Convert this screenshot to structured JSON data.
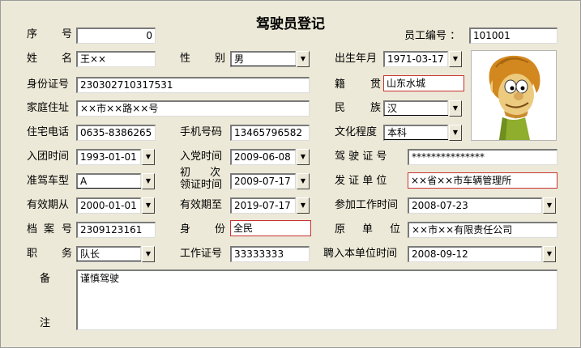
{
  "form": {
    "title": "驾驶员登记",
    "labels": {
      "seq_a": "序",
      "seq_b": "号",
      "employee_no": "员工编号 ：",
      "name_a": "姓",
      "name_b": "名",
      "gender_a": "性",
      "gender_b": "别",
      "birth_date": "出生年月",
      "id_card": "身份证号",
      "origin_a": "籍",
      "origin_b": "贯",
      "address": "家庭住址",
      "ethnic_a": "民",
      "ethnic_b": "族",
      "home_phone": "住宅电话",
      "mobile": "手机号码",
      "education": "文化程度",
      "league_date": "入团时间",
      "party_date": "入党时间",
      "license_no": "驾 驶 证 号",
      "vehicle_type": "准驾车型",
      "first_issue_a": "初 次",
      "first_issue_b": "领证时间",
      "issuer": "发 证 单 位",
      "valid_from": "有效期从",
      "valid_to": "有效期至",
      "work_start": "参加工作时间",
      "file_no_a": "档",
      "file_no_b": "案",
      "file_no_c": "号",
      "status_a": "身",
      "status_b": "份",
      "prev_unit_a": "原",
      "prev_unit_b": "单",
      "prev_unit_c": "位",
      "position_a": "职",
      "position_b": "务",
      "work_id": "工作证号",
      "hire_date": "聘入本单位时间",
      "remarks_a": "备",
      "remarks_b": "注"
    },
    "values": {
      "seq": "0",
      "employee_no": "101001",
      "name": "王××",
      "gender": "男",
      "birth_date": "1971-03-17",
      "id_card": "230302710317531",
      "origin": "山东水城",
      "address": "××市××路××号",
      "ethnic": "汉",
      "home_phone": "0635-8386265",
      "mobile": "13465796582",
      "education": "本科",
      "league_date": "1993-01-01",
      "party_date": "2009-06-08",
      "license_no": "***************",
      "vehicle_type": "A",
      "first_issue_date": "2009-07-17",
      "issuer": "××省××市车辆管理所",
      "valid_from": "2000-01-01",
      "valid_to": "2019-07-17",
      "work_start": "2008-07-23",
      "file_no": "2309123161",
      "status": "全民",
      "prev_unit": "××市××有限责任公司",
      "position": "队长",
      "work_id": "33333333",
      "hire_date": "2008-09-12",
      "remarks": "谨慎驾驶"
    },
    "dropdown_glyph": "▼",
    "photo": {
      "icon": "cartoon-portrait",
      "colors": {
        "hair": "#d2881e",
        "skin": "#eccb7f",
        "shirt": "#8fae2e"
      }
    },
    "colors": {
      "background": "#ece9d8",
      "highlight_border": "#c83232"
    }
  }
}
